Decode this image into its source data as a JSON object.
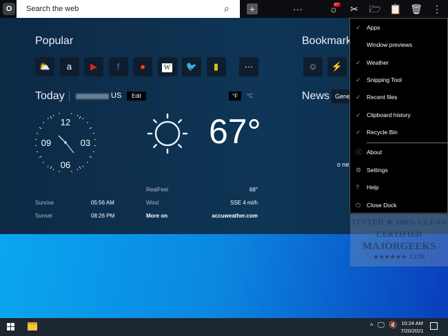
{
  "topbar": {
    "logo": "O",
    "search_placeholder": "Search the web",
    "add": "+",
    "more": "···",
    "notif_badge": "67°",
    "kebab": "⋮"
  },
  "popular": {
    "title": "Popular",
    "tiles": [
      {
        "name": "weather",
        "glyph": "⛅",
        "color": "#f0c040"
      },
      {
        "name": "amazon",
        "glyph": "a",
        "color": "#fff"
      },
      {
        "name": "youtube",
        "glyph": "▶",
        "color": "#e02020"
      },
      {
        "name": "facebook",
        "glyph": "f",
        "color": "#1877f2"
      },
      {
        "name": "reddit",
        "glyph": "●",
        "color": "#ff4500"
      },
      {
        "name": "wikipedia",
        "glyph": "W",
        "color": "#222"
      },
      {
        "name": "twitter",
        "glyph": "🐦",
        "color": "#1da1f2"
      },
      {
        "name": "tv",
        "glyph": "▮",
        "color": "#e0c020"
      }
    ],
    "more": "···"
  },
  "bookmarks": {
    "title": "Bookmarks",
    "tiles": [
      {
        "name": "bookmark-1",
        "glyph": "☺",
        "color": "#bbb"
      },
      {
        "name": "bookmark-2",
        "glyph": "⚡",
        "color": "#ffd400"
      }
    ]
  },
  "today": {
    "title": "Today",
    "location": "US",
    "edit": "Edit",
    "unit_f": "°F",
    "unit_c": "°C",
    "clock": {
      "n12": "12",
      "n03": "03",
      "n06": "06",
      "n09": "09"
    },
    "temperature": "67°",
    "rows": {
      "realfeel_label": "RealFeel",
      "realfeel": "68°",
      "sunrise_label": "Sunrise",
      "sunrise": "05:56 AM",
      "wind_label": "Wind",
      "wind": "SSE 4 mi/h",
      "sunset_label": "Sunset",
      "sunset": "08:26 PM",
      "more_label": "More on",
      "more_link": "accuweather.com"
    }
  },
  "news": {
    "title": "News",
    "tab": "Gene",
    "empty": "o ne"
  },
  "menu": {
    "items": [
      {
        "label": "Apps",
        "icon": "✓"
      },
      {
        "label": "Window previews",
        "icon": ""
      },
      {
        "label": "Weather",
        "icon": "✓"
      },
      {
        "label": "Snipping Tool",
        "icon": "✓"
      },
      {
        "label": "Recent files",
        "icon": "✓"
      },
      {
        "label": "Clipboard history",
        "icon": "✓"
      },
      {
        "label": "Recycle Bin",
        "icon": "✓"
      }
    ],
    "actions": [
      {
        "label": "About",
        "icon": "ⓘ"
      },
      {
        "label": "Settings",
        "icon": "⚙"
      },
      {
        "label": "Help",
        "icon": "?"
      },
      {
        "label": "Close Dock",
        "icon": "⏻"
      }
    ]
  },
  "watermark": {
    "line1": "TESTED ★ 100% CLEAN",
    "line2": "CERTIFIED",
    "line3": "MAJORGEEKS",
    "line4": "★★★★★★ .COM"
  },
  "taskbar": {
    "time": "10:24 AM",
    "date": "7/20/2021"
  }
}
